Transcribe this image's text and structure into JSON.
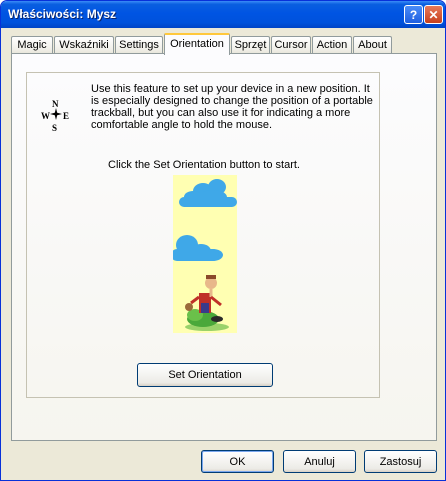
{
  "window": {
    "title": "Właściwości: Mysz",
    "help_glyph": "?",
    "close_glyph": "✕"
  },
  "tabs": [
    {
      "label": "Magic"
    },
    {
      "label": "Wskaźniki"
    },
    {
      "label": "Settings"
    },
    {
      "label": "Orientation",
      "active": true
    },
    {
      "label": "Sprzęt"
    },
    {
      "label": "Cursor"
    },
    {
      "label": "Action"
    },
    {
      "label": "About"
    }
  ],
  "orientation": {
    "compass": {
      "n": "N",
      "s": "S",
      "w": "W",
      "e": "E"
    },
    "description": "Use this feature to set up your device in a new position. It is especially designed to change the position of a portable trackball, but you can also use it for indicating a more comfortable angle to hold the mouse.",
    "hint": "Click the Set Orientation button to start.",
    "set_button": "Set Orientation"
  },
  "buttons": {
    "ok": "OK",
    "cancel": "Anuluj",
    "apply": "Zastosuj"
  },
  "colors": {
    "titlebar": "#0054e3",
    "dialog_bg": "#ece9d8",
    "illustration_bg": "#ffffb2",
    "active_tab_accent": "#ffc83c"
  }
}
